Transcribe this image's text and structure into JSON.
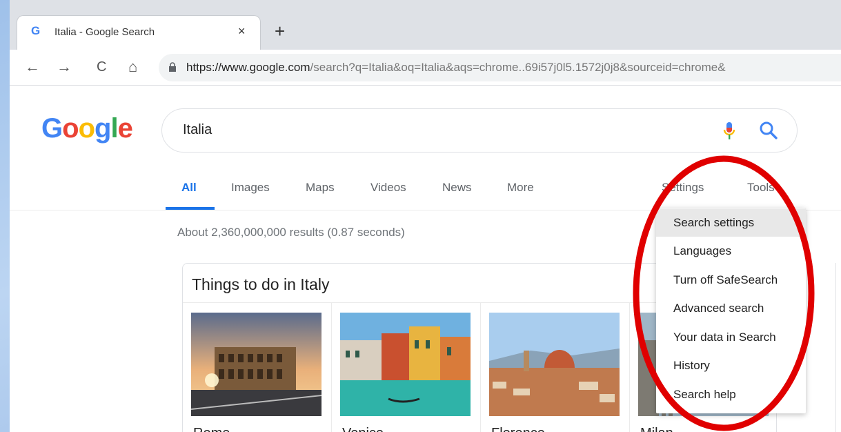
{
  "browser": {
    "tab_title": "Italia - Google Search",
    "tab_close": "×",
    "new_tab": "+",
    "back": "←",
    "forward": "→",
    "reload": "C",
    "home": "⌂",
    "url_host": "https://www.google.com",
    "url_path": "/search?q=Italia&oq=Italia&aqs=chrome..69i57j0l5.1572j0j8&sourceid=chrome&"
  },
  "search": {
    "query": "Italia"
  },
  "nav_tabs": [
    {
      "label": "All"
    },
    {
      "label": "Images"
    },
    {
      "label": "Maps"
    },
    {
      "label": "Videos"
    },
    {
      "label": "News"
    },
    {
      "label": "More"
    }
  ],
  "settings_label": "Settings",
  "tools_label": "Tools",
  "result_stats": "About 2,360,000,000 results (0.87 seconds)",
  "card": {
    "title": "Things to do in Italy",
    "places": [
      {
        "name": "Rome"
      },
      {
        "name": "Venice"
      },
      {
        "name": "Florence"
      },
      {
        "name": "Milan"
      }
    ]
  },
  "settings_menu": [
    {
      "label": "Search settings"
    },
    {
      "label": "Languages"
    },
    {
      "label": "Turn off SafeSearch"
    },
    {
      "label": "Advanced search"
    },
    {
      "label": "Your data in Search"
    },
    {
      "label": "History"
    },
    {
      "label": "Search help"
    }
  ],
  "colors": {
    "accent": "#1a73e8",
    "annotation_ring": "#e00000"
  }
}
